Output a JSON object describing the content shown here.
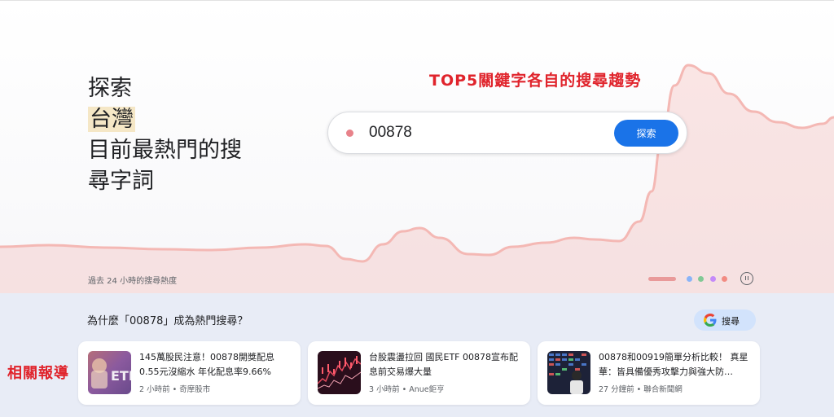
{
  "hero": {
    "headline": [
      "探索",
      "台灣",
      "目前最熱門的搜",
      "尋字詞"
    ],
    "annotation_top": "TOP5關鍵字各自的搜尋趨勢",
    "caption": "過去 24 小時的搜尋熱度",
    "search": {
      "value": "00878",
      "button_label": "探索"
    },
    "carousel": {
      "active_color": "#e99a9a",
      "dot_colors": [
        "#8ab4f8",
        "#81c995",
        "#c58af9",
        "#f28b82"
      ]
    },
    "trend_color": "#f4b8b4"
  },
  "bottom": {
    "question": "為什麼「00878」成為熱門搜尋？",
    "search_button_label": "搜尋",
    "annotation_side": "相關報導",
    "articles": [
      {
        "title": "145萬股民注意！00878開獎配息0.55元沒縮水 年化配息率9.66%",
        "meta": "2 小時前 • 奇摩股市",
        "thumb_icon": "etf-photo"
      },
      {
        "title": "台股震盪拉回 國民ETF 00878宣布配息前交易爆大量",
        "meta": "3 小時前 • Anue鉅亨",
        "thumb_icon": "stock-chart-photo"
      },
      {
        "title": "00878和00919簡單分析比較！ 真星華：皆具備優秀攻擊力與強大防…",
        "meta": "27 分鐘前 • 聯合新聞網",
        "thumb_icon": "stock-board-photo"
      }
    ]
  }
}
